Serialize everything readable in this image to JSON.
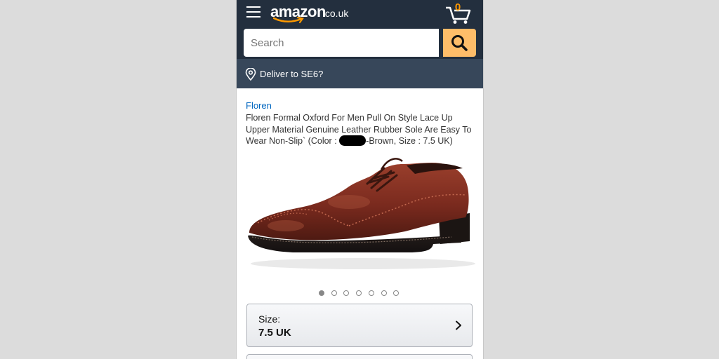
{
  "header": {
    "logo_text": "amazon",
    "logo_tld": ".co.uk",
    "cart_count": "0",
    "colors": {
      "topbar": "#232f3e",
      "accent": "#febd69",
      "cart_count": "#ff9900"
    },
    "icons": {
      "menu": "hamburger-icon",
      "cart": "cart-icon"
    }
  },
  "search": {
    "placeholder": "Search",
    "value": "",
    "icon": "search-icon"
  },
  "delivery": {
    "label": "Deliver to SE6?",
    "icon": "location-pin-icon"
  },
  "product": {
    "brand": "Floren",
    "title_part1": "Floren Formal Oxford For Men Pull On Style Lace Up Upper Material Genuine Leather Rubber Sole Are Easy To Wear Non-Slip` (Color :",
    "title_part2": "-Brown, Size : 7.5 UK)",
    "image_icon": "brown-oxford-shoe-image",
    "image_count": 7,
    "active_image_index": 0
  },
  "size_selector": {
    "label": "Size:",
    "value": "7.5 UK",
    "icon": "chevron-right-icon"
  }
}
